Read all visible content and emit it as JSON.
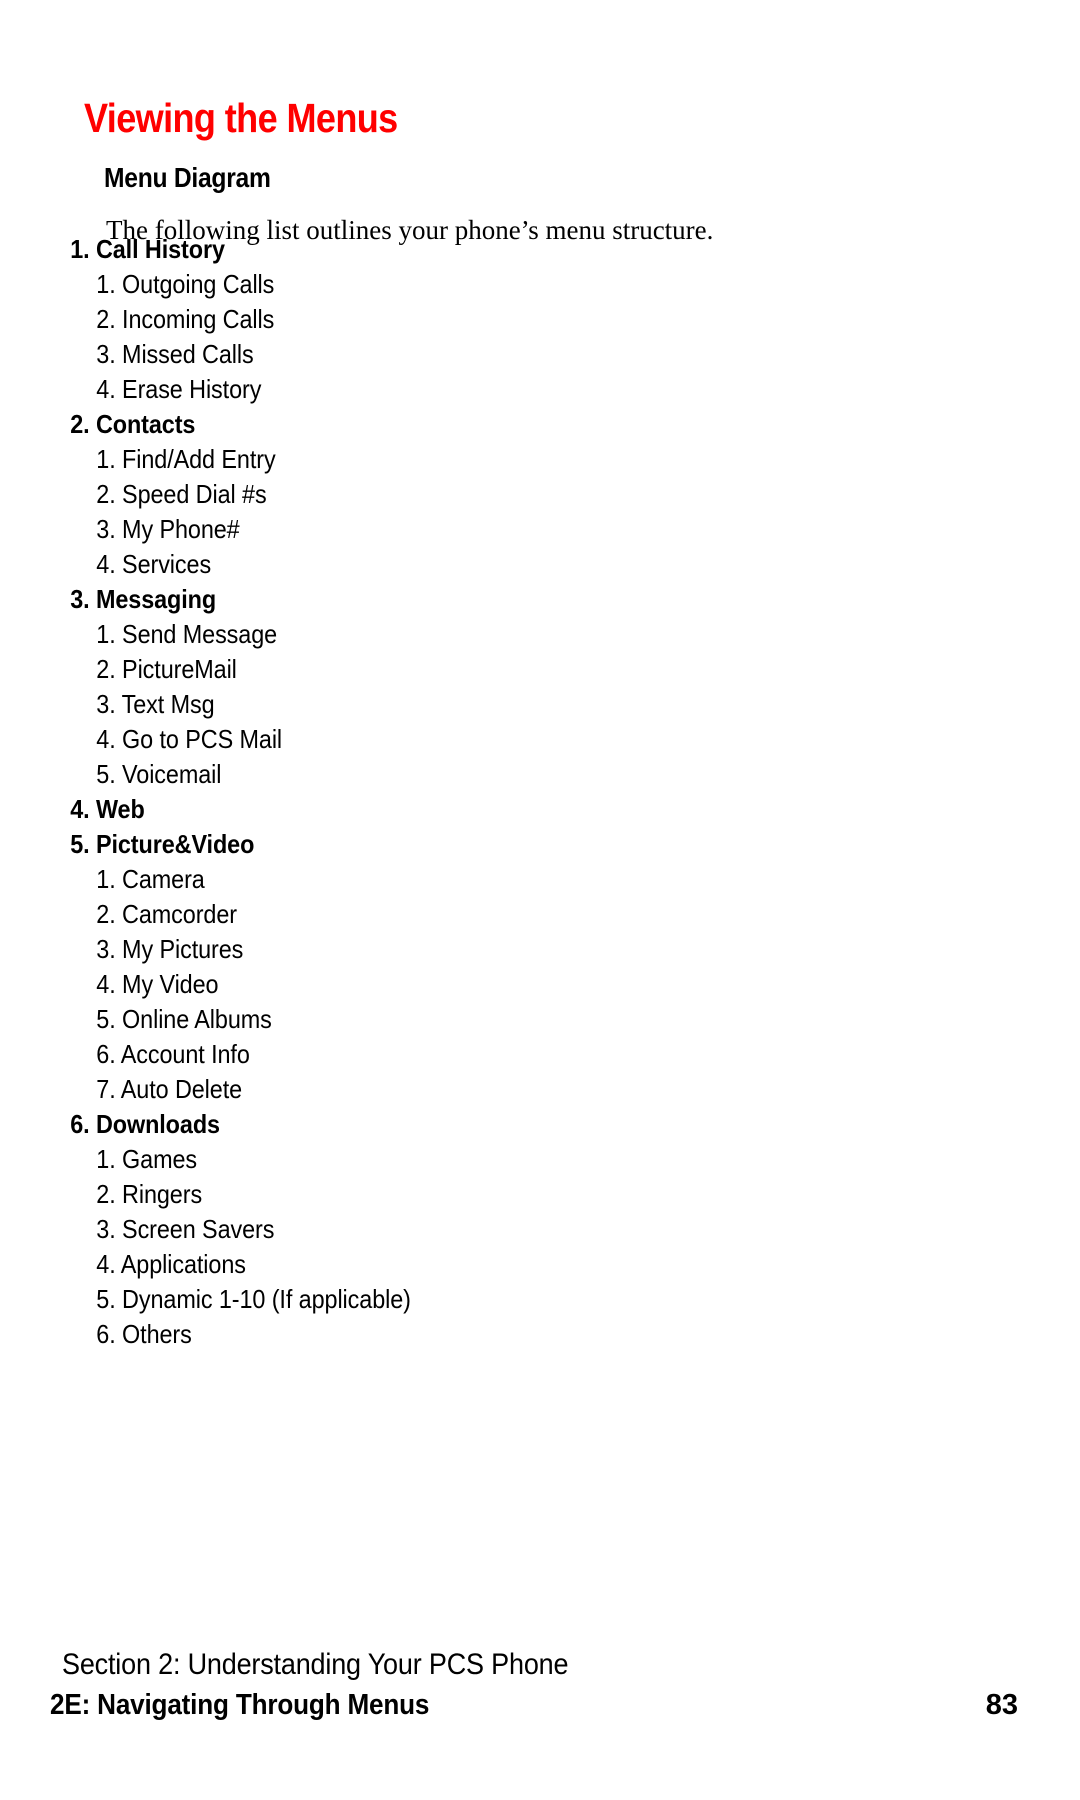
{
  "page": {
    "title": "Viewing the Menus",
    "title_color": "#ff0000",
    "sub_heading": "Menu Diagram",
    "intro": "The following list outlines your phone’s menu structure.",
    "background_color": "#ffffff",
    "text_color": "#000000"
  },
  "menu": [
    {
      "label": "1. Call History",
      "items": [
        "1. Outgoing Calls",
        "2. Incoming Calls",
        "3. Missed Calls",
        "4. Erase History"
      ]
    },
    {
      "label": "2. Contacts",
      "items": [
        "1. Find/Add Entry",
        "2. Speed Dial #s",
        "3. My Phone#",
        "4. Services"
      ]
    },
    {
      "label": "3. Messaging",
      "items": [
        "1. Send Message",
        "2. PictureMail",
        "3. Text Msg",
        "4. Go to PCS Mail",
        "5. Voicemail"
      ]
    },
    {
      "label": "4. Web",
      "items": []
    },
    {
      "label": "5. Picture&Video",
      "items": [
        "1. Camera",
        "2. Camcorder",
        "3. My Pictures",
        "4. My Video",
        "5. Online Albums",
        "6. Account Info",
        "7. Auto Delete"
      ]
    },
    {
      "label": "6. Downloads",
      "items": [
        "1. Games",
        "2. Ringers",
        "3. Screen Savers",
        "4. Applications",
        "5. Dynamic 1-10 (If applicable)",
        "6. Others"
      ]
    }
  ],
  "footer": {
    "section": "Section 2: Understanding Your PCS Phone",
    "chapter": "2E: Navigating Through Menus",
    "page_number": "83"
  }
}
